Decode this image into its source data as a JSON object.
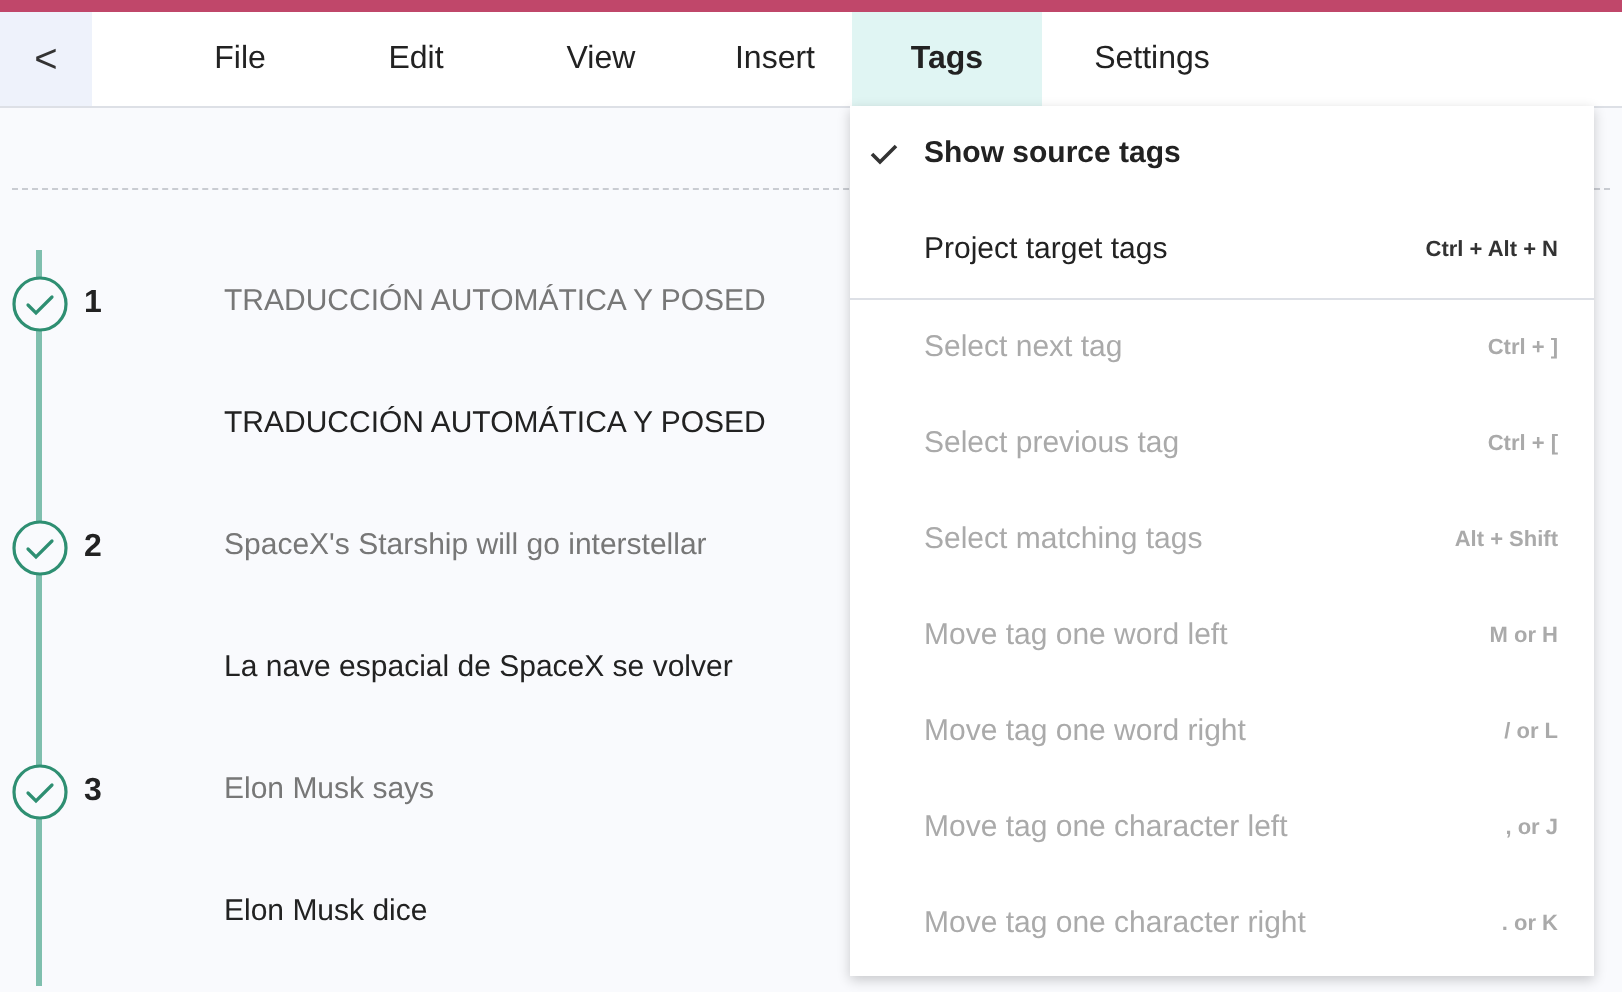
{
  "menubar": {
    "back": "<",
    "items": [
      {
        "label": "File",
        "selected": false
      },
      {
        "label": "Edit",
        "selected": false
      },
      {
        "label": "View",
        "selected": false
      },
      {
        "label": "Insert",
        "selected": false
      },
      {
        "label": "Tags",
        "selected": true
      },
      {
        "label": "Settings",
        "selected": false
      }
    ]
  },
  "segments": [
    {
      "number": "1",
      "confirmed": true,
      "source": "TRADUCCIÓN AUTOMÁTICA Y POSED",
      "target": "TRADUCCIÓN AUTOMÁTICA Y POSED"
    },
    {
      "number": "2",
      "confirmed": true,
      "source": "SpaceX's Starship will go interstellar",
      "target": "La nave espacial de SpaceX se volver"
    },
    {
      "number": "3",
      "confirmed": true,
      "source": "Elon Musk says",
      "target": "Elon Musk dice"
    }
  ],
  "dropdown": {
    "groups": [
      [
        {
          "label": "Show source tags",
          "checked": true,
          "disabled": false
        },
        {
          "label": "Project target tags",
          "shortcut": "Ctrl + Alt + N",
          "checked": false,
          "disabled": false
        }
      ],
      [
        {
          "label": "Select next tag",
          "shortcut": "Ctrl + ]",
          "checked": false,
          "disabled": true
        },
        {
          "label": "Select previous tag",
          "shortcut": "Ctrl + [",
          "checked": false,
          "disabled": true
        },
        {
          "label": "Select matching tags",
          "shortcut": "Alt + Shift",
          "checked": false,
          "disabled": true
        },
        {
          "label": "Move tag one word left",
          "shortcut": "M or H",
          "checked": false,
          "disabled": true
        },
        {
          "label": "Move tag one word right",
          "shortcut": "/ or L",
          "checked": false,
          "disabled": true
        },
        {
          "label": "Move tag one character left",
          "shortcut": ", or J",
          "checked": false,
          "disabled": true
        },
        {
          "label": "Move tag one character right",
          "shortcut": ". or K",
          "checked": false,
          "disabled": true
        }
      ]
    ]
  }
}
